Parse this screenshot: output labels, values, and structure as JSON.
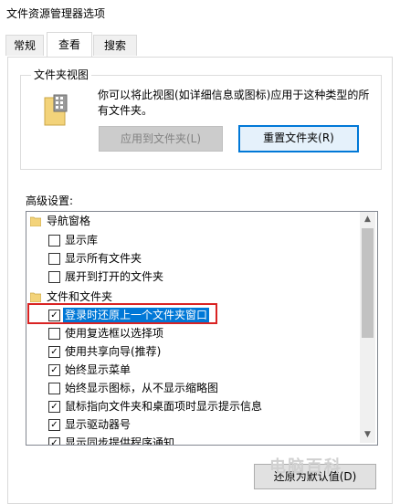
{
  "window": {
    "title": "文件资源管理器选项"
  },
  "tabs": [
    {
      "label": "常规"
    },
    {
      "label": "查看"
    },
    {
      "label": "搜索"
    }
  ],
  "folder_view": {
    "label": "文件夹视图",
    "description": "你可以将此视图(如详细信息或图标)应用于这种类型的所有文件夹。",
    "apply_button": "应用到文件夹(L)",
    "reset_button": "重置文件夹(R)"
  },
  "advanced": {
    "label": "高级设置:",
    "items": [
      {
        "type": "category",
        "label": "导航窗格"
      },
      {
        "type": "option",
        "label": "显示库",
        "checked": false
      },
      {
        "type": "option",
        "label": "显示所有文件夹",
        "checked": false
      },
      {
        "type": "option",
        "label": "展开到打开的文件夹",
        "checked": false
      },
      {
        "type": "category",
        "label": "文件和文件夹"
      },
      {
        "type": "option",
        "label": "登录时还原上一个文件夹窗口",
        "checked": true,
        "selected": true
      },
      {
        "type": "option",
        "label": "使用复选框以选择项",
        "checked": false
      },
      {
        "type": "option",
        "label": "使用共享向导(推荐)",
        "checked": true
      },
      {
        "type": "option",
        "label": "始终显示菜单",
        "checked": true
      },
      {
        "type": "option",
        "label": "始终显示图标，从不显示缩略图",
        "checked": false
      },
      {
        "type": "option",
        "label": "鼠标指向文件夹和桌面项时显示提示信息",
        "checked": true
      },
      {
        "type": "option",
        "label": "显示驱动器号",
        "checked": true
      },
      {
        "type": "option",
        "label": "显示同步提供程序通知",
        "checked": true
      }
    ],
    "restore_defaults_button": "还原为默认值(D)"
  },
  "watermark": "电脑百科",
  "colors": {
    "accent": "#0078d7",
    "highlight_border": "#d92323"
  }
}
